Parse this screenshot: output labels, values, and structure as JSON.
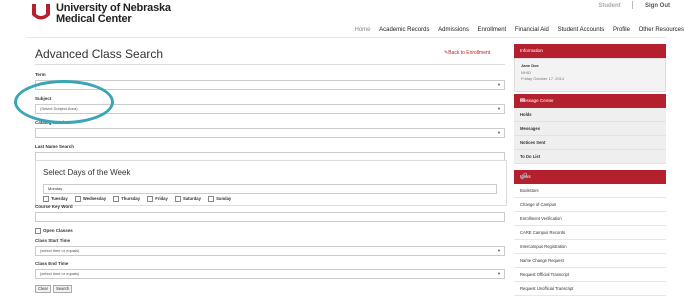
{
  "header": {
    "brand_line1": "University of Nebraska",
    "brand_line2": "Medical Center",
    "top_links": [
      "Student",
      "Sign Out"
    ]
  },
  "nav": {
    "items": [
      "Home",
      "Academic Records",
      "Admissions",
      "Enrollment",
      "Financial Aid",
      "Student Accounts",
      "Profile",
      "Other Resources"
    ]
  },
  "page": {
    "title": "Advanced Class Search",
    "back_link": "Back to Enrollment"
  },
  "form": {
    "term_label": "Term",
    "subject_label": "Subject",
    "subject_value": "(Select Subject Area)",
    "catalog_label": "Catalog Number",
    "last_name_label": "Last Name Search",
    "days_title": "Select Days of the Week",
    "days_selected": "Monday",
    "days": [
      "Tuesday",
      "Wednesday",
      "Thursday",
      "Friday",
      "Saturday",
      "Sunday"
    ],
    "course_keyword_label": "Course Key Word",
    "open_classes_label": "Open Classes",
    "start_time_label": "Class Start Time",
    "start_time_value": "(select time or equals)",
    "end_time_label": "Class End Time",
    "end_time_value": "(select time or equals)",
    "clear_button": "Clear",
    "search_button": "Search"
  },
  "sidebar": {
    "information_title": "Information",
    "info_name": "Jane Doe",
    "info_id": "NHID",
    "info_date": "Friday October 17, 2014",
    "message_center_title": "Message Center",
    "message_items": [
      "Holds",
      "Messages",
      "Notices Sent",
      "To Do List"
    ],
    "links_title": "Links",
    "links": [
      "Bookstore",
      "Change of Campus",
      "Enrollment Verification",
      "CARE Campus Records",
      "Intercampus Registration",
      "Name Change Request",
      "Request Official Transcript",
      "Request Unofficial Transcript"
    ]
  },
  "colors": {
    "brand_red": "#b5202e",
    "highlight_teal": "#3aa6b5"
  }
}
